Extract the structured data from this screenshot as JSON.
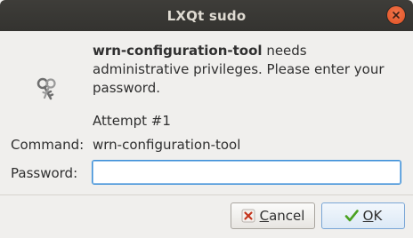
{
  "window": {
    "title": "LXQt sudo"
  },
  "message": {
    "program": "wrn-configuration-tool",
    "text": " needs administrative privileges. Please enter your password."
  },
  "attempt": "Attempt #1",
  "command": {
    "label": "Command:",
    "value": "wrn-configuration-tool"
  },
  "password": {
    "label": "Password:",
    "value": ""
  },
  "buttons": {
    "cancel": {
      "mnemonic": "C",
      "rest": "ancel",
      "icon": "cancel-icon"
    },
    "ok": {
      "mnemonic": "O",
      "rest": "K",
      "icon": "checkmark-icon"
    }
  },
  "icons": {
    "dialog": "keys-icon",
    "close": "close-icon"
  },
  "colors": {
    "titlebar": "#3c3b37",
    "close": "#e8592b",
    "focus": "#3d90d8",
    "ok_check": "#4aa121",
    "cancel_x": "#c4351d"
  }
}
